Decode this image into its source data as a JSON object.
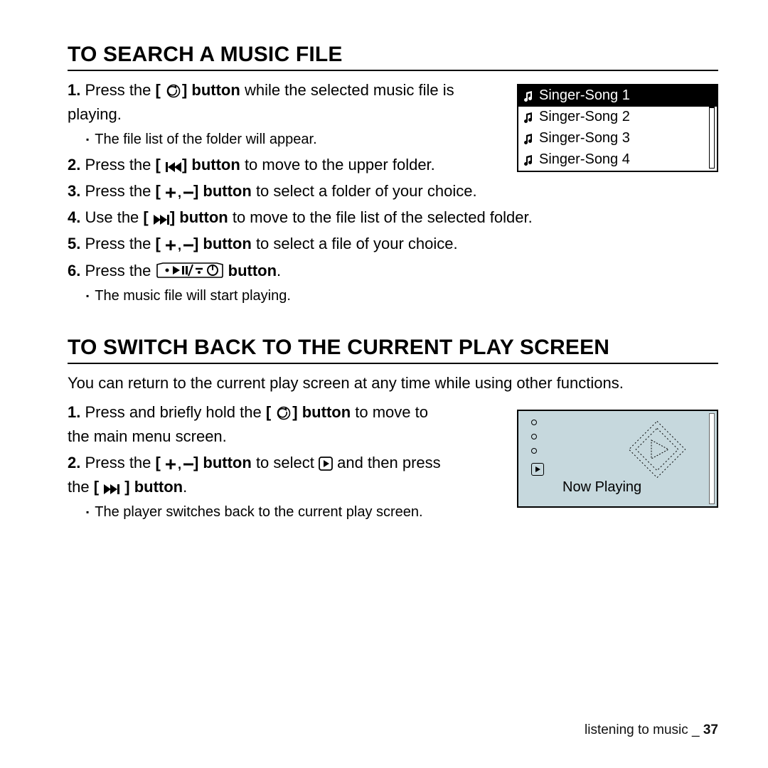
{
  "section1": {
    "title": "TO SEARCH A MUSIC FILE",
    "steps": [
      {
        "num": "1.",
        "pre": "Press the ",
        "bold": "] button",
        "post": " while the selected music file is playing.",
        "icon": "back-circle",
        "bracket": true
      },
      {
        "num": "2.",
        "pre": "Press the ",
        "bold": "] button",
        "post": " to move to the upper folder.",
        "icon": "prev",
        "bracket": true
      },
      {
        "num": "3.",
        "pre": "Press the ",
        "bold": "] button",
        "post": " to select a folder of your choice.",
        "icon": "plusminus",
        "bracket": true
      },
      {
        "num": "4.",
        "pre": "Use the ",
        "bold": "] button",
        "post": " to move to the file list of the selected folder.",
        "icon": "next",
        "bracket": true
      },
      {
        "num": "5.",
        "pre": "Press the ",
        "bold": "] button",
        "post": " to select a file of your choice.",
        "icon": "plusminus",
        "bracket": true
      },
      {
        "num": "6.",
        "pre": "Press the ",
        "bold": " button",
        "post": ".",
        "icon": "power-play",
        "bracket": false
      }
    ],
    "sub1": "The file list of the folder will appear.",
    "sub6": "The music file will start playing.",
    "songs": [
      "Singer-Song 1",
      "Singer-Song 2",
      "Singer-Song 3",
      "Singer-Song 4"
    ]
  },
  "section2": {
    "title": "TO SWITCH BACK TO THE CURRENT PLAY SCREEN",
    "intro": "You can return to the current play screen at any time while using other functions.",
    "step1": {
      "num": "1.",
      "pre": "Press and briefly hold the ",
      "bold": "] button",
      "post": " to move to the main menu screen."
    },
    "step2": {
      "num": "2.",
      "pre": "Press the ",
      "mid_bold": "] button",
      "mid": " to select ",
      "np": "<Now Playing>",
      "post_pre": " and then press the ",
      "post_bold": "] button",
      "post": "."
    },
    "sub": "The player switches back to the current play screen.",
    "now_playing": "Now Playing"
  },
  "footer": {
    "text": "listening to music _ ",
    "page": "37"
  }
}
